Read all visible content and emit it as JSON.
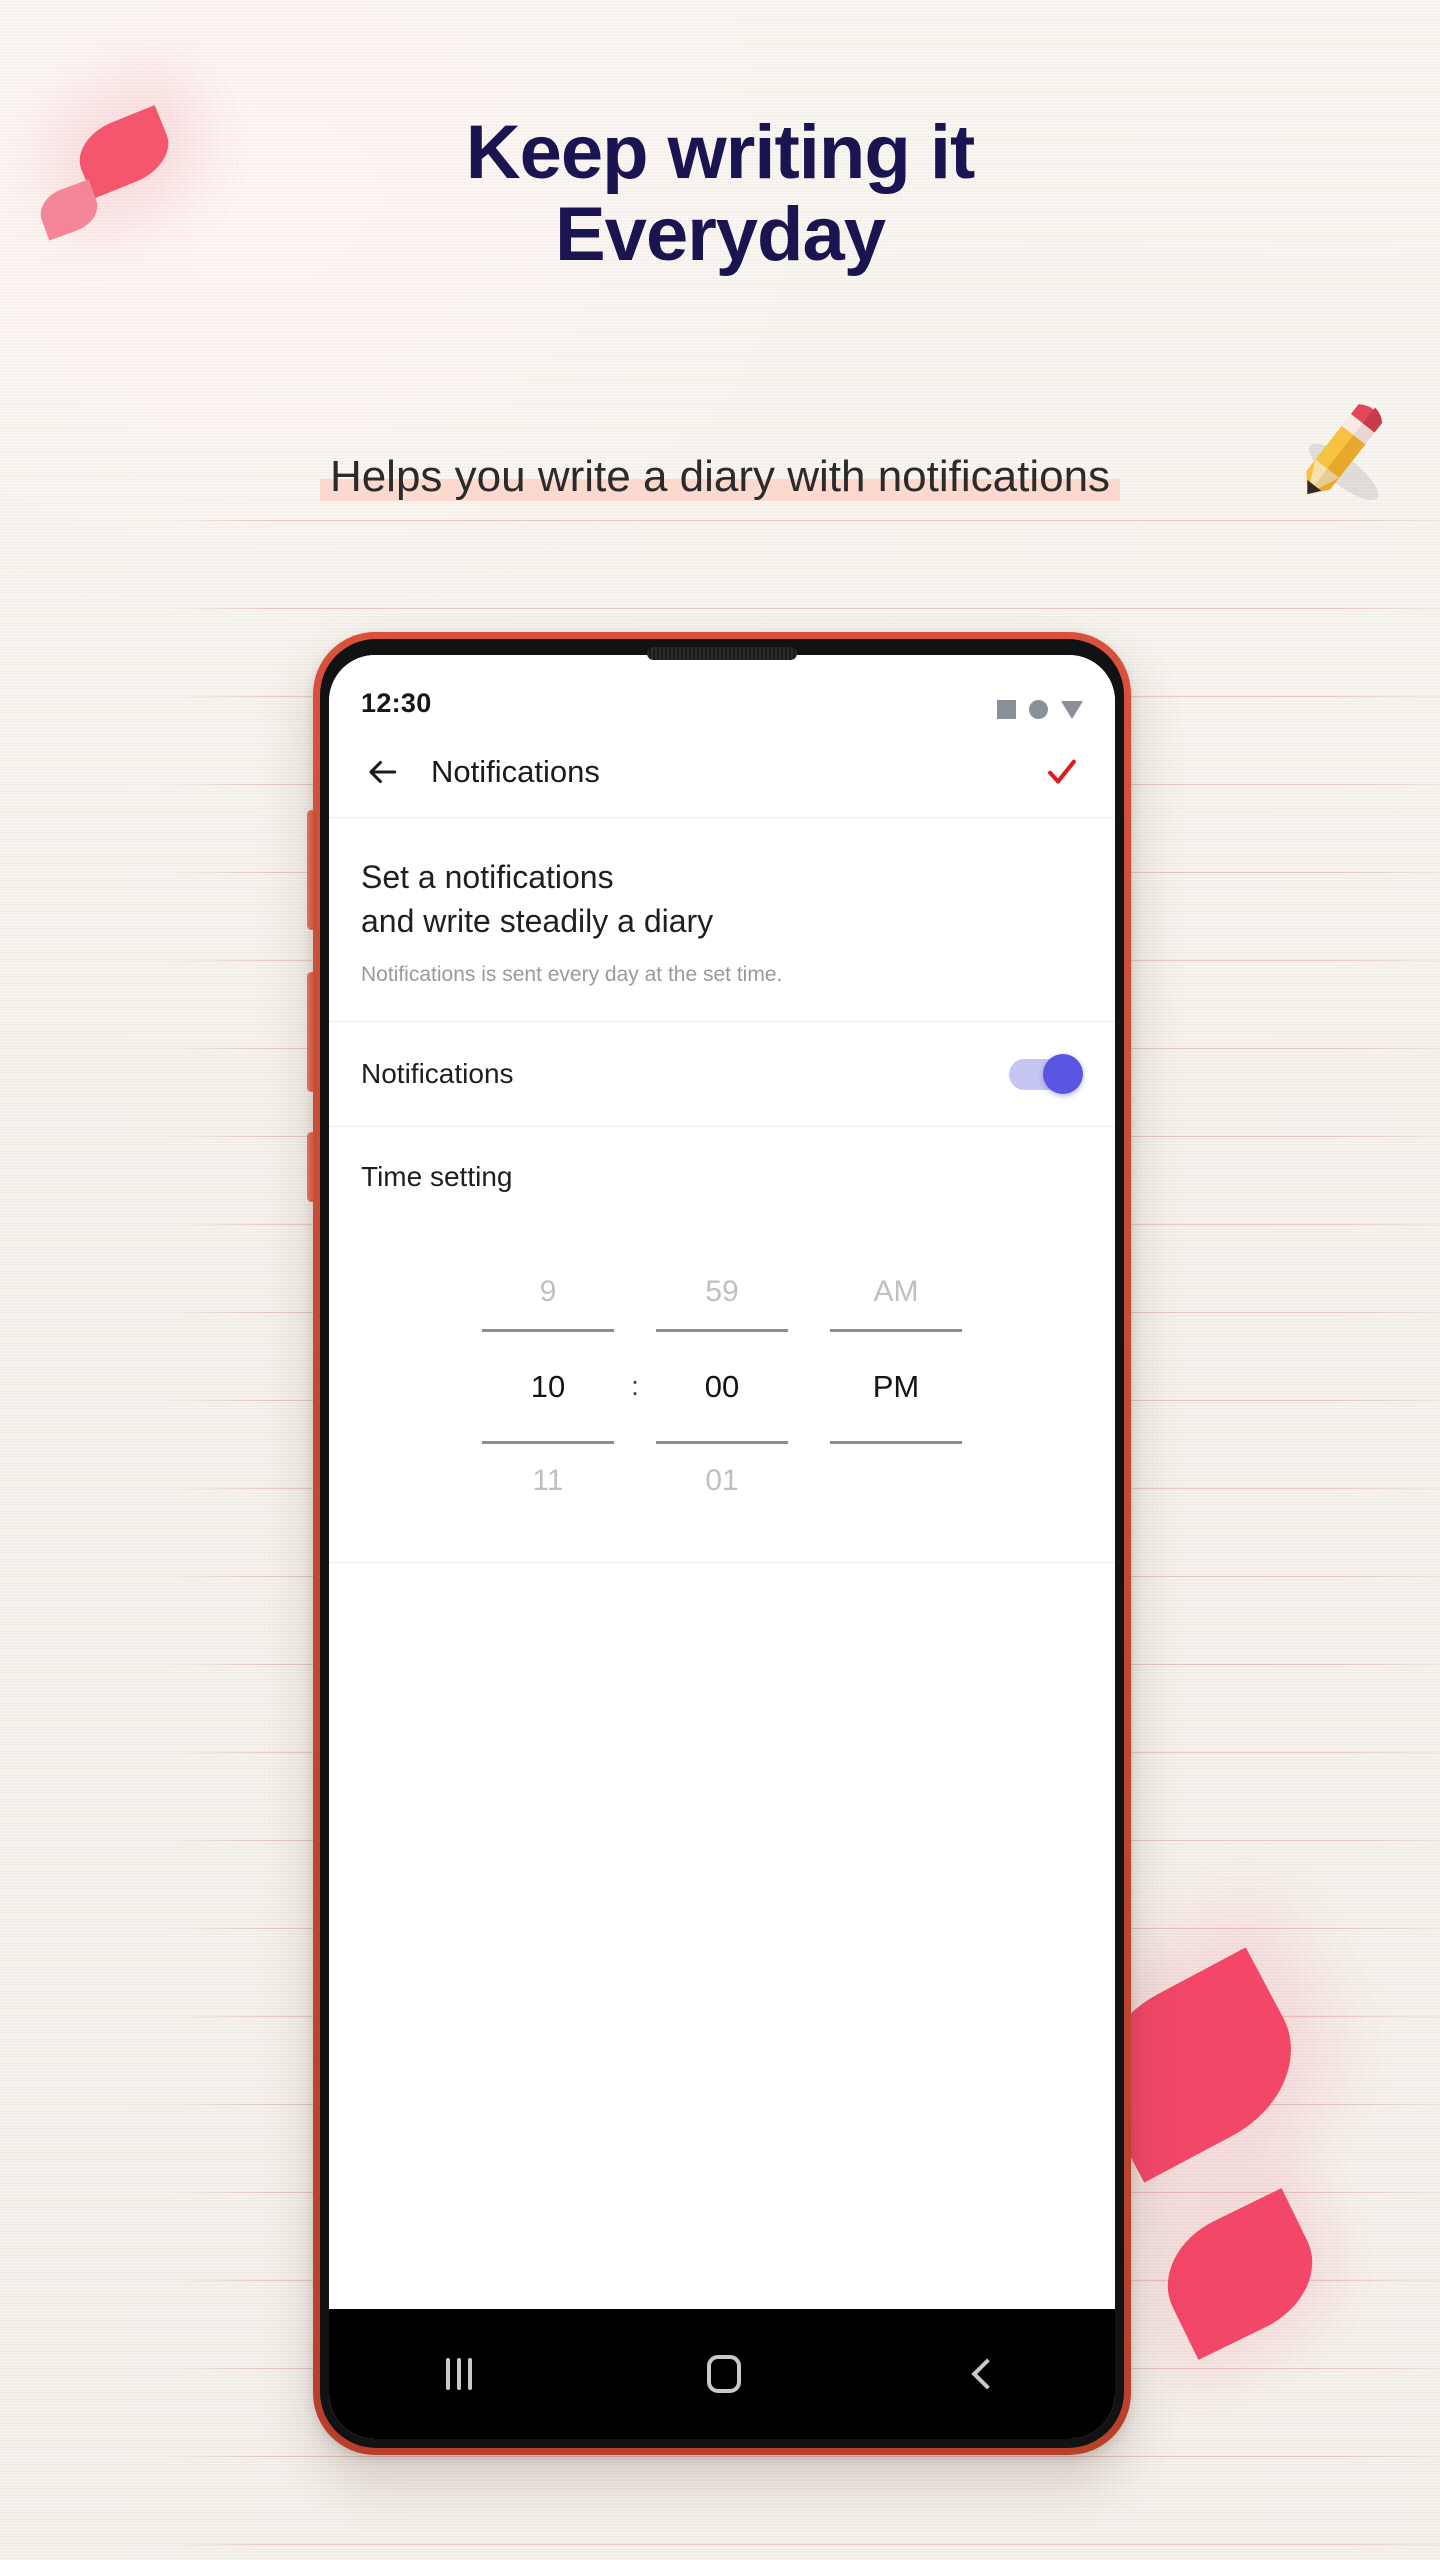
{
  "promo": {
    "headline_line1": "Keep writing it",
    "headline_line2": "Everyday",
    "subtitle": "Helps you write a diary with notifications",
    "headline_color": "#1a1550",
    "subtitle_highlight_color": "#fbd9ce",
    "background_color": "#f3f0ea",
    "petal_color": "#f24767",
    "pencil_icon": "pencil-emoji"
  },
  "phone": {
    "frame_color": "#c4472f",
    "statusbar": {
      "time": "12:30",
      "icons": [
        "square-indicator-icon",
        "circle-indicator-icon",
        "triangle-indicator-icon"
      ]
    },
    "appbar": {
      "back_icon": "arrow-left-icon",
      "title": "Notifications",
      "confirm_icon": "checkmark-icon",
      "confirm_color": "#e11b1b"
    },
    "intro": {
      "line1": "Set a notifications",
      "line2": "and write steadily a diary",
      "description": "Notifications is sent every day at the set time."
    },
    "notifications_row": {
      "label": "Notifications",
      "toggle_state": "on",
      "toggle_track_color": "#c6c6f3",
      "toggle_thumb_color": "#5b56e2"
    },
    "time_setting_row": {
      "label": "Time setting"
    },
    "time_picker": {
      "hour": {
        "prev": "9",
        "selected": "10",
        "next": "11"
      },
      "separator": ":",
      "minute": {
        "prev": "59",
        "selected": "00",
        "next": "01"
      },
      "meridiem": {
        "prev": "AM",
        "selected": "PM",
        "next": ""
      }
    },
    "navbar": {
      "recents_icon": "recents-icon",
      "home_icon": "home-icon",
      "back_icon": "nav-back-icon"
    }
  }
}
